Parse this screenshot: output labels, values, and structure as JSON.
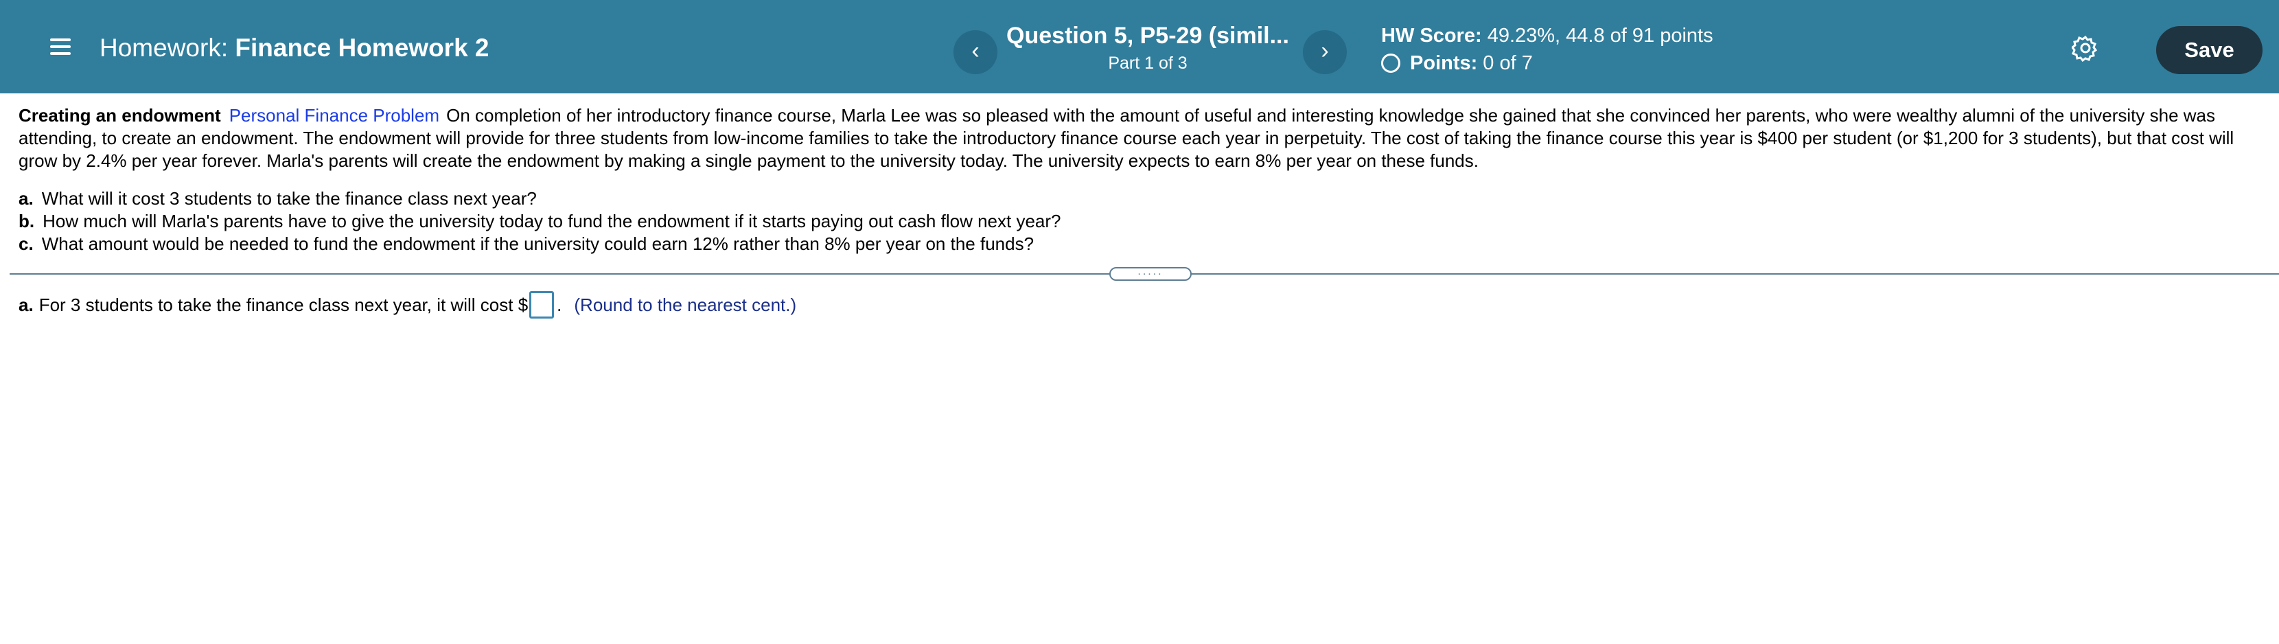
{
  "header": {
    "menu_icon": "hamburger-menu-icon",
    "homework_prefix": "Homework:",
    "homework_name": "Finance Homework 2",
    "prev_icon": "‹",
    "next_icon": "›",
    "question_title": "Question 5, P5-29 (simil...",
    "question_part": "Part 1 of 3",
    "hw_score_label": "HW Score:",
    "hw_score_value": "49.23%, 44.8 of 91 points",
    "points_label": "Points:",
    "points_value": "0 of 7",
    "settings_icon": "gear-icon",
    "save_label": "Save"
  },
  "problem": {
    "title": "Creating an endowment",
    "category": "Personal Finance Problem",
    "body": "On completion of her introductory finance course, Marla Lee was so pleased with the amount of useful and interesting knowledge she gained that she convinced her parents, who were wealthy alumni of the university she was attending, to create an endowment.  The endowment will provide for three  students from low-income families to take the introductory finance course each year in perpetuity.  The cost of taking the finance course this year is $400 per student (or $1,200 for 3 students), but that cost will grow by 2.4% per year forever. Marla's parents will create the endowment by making a single payment to the university today. The university expects to earn 8% per year on these funds.",
    "questions": [
      {
        "letter": "a.",
        "text": "What will it cost 3 students to take the finance class next year?"
      },
      {
        "letter": "b.",
        "text": "How much will Marla's parents have to give the university today to fund the endowment if it starts paying out cash flow next year?"
      },
      {
        "letter": "c.",
        "text": "What amount would be needed to fund the endowment if the university could earn 12% rather than 8% per year on the funds?"
      }
    ]
  },
  "divider": {
    "handle_text": "....."
  },
  "answer": {
    "letter": "a.",
    "prompt": "For 3 students to take the finance class next year, it will cost $",
    "value": "",
    "suffix": ".",
    "hint": "(Round to the nearest cent.)"
  },
  "colors": {
    "header_bg": "#317d9c",
    "save_bg": "#1e3441",
    "link": "#1a3ce6",
    "hint": "#1a2f8a"
  }
}
